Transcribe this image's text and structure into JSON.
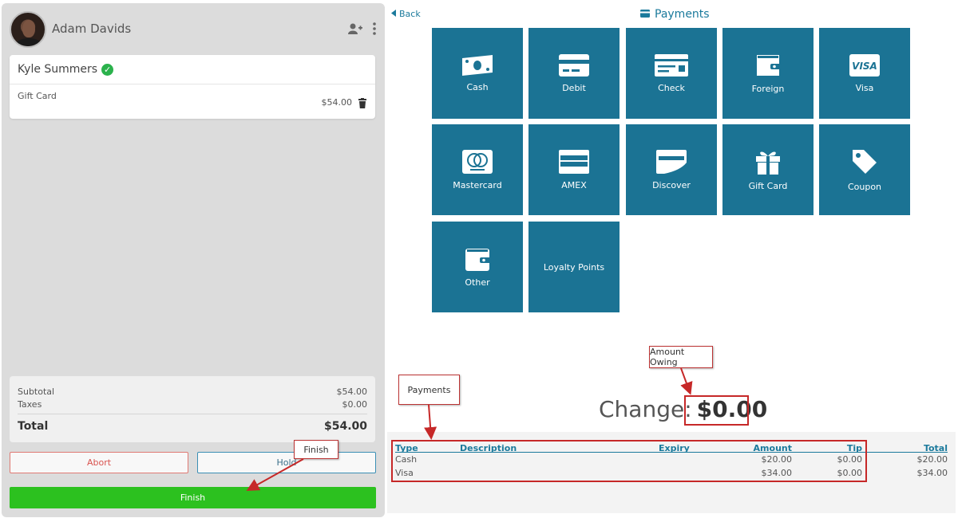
{
  "user": {
    "name": "Adam Davids"
  },
  "customer": {
    "name": "Kyle Summers"
  },
  "items": [
    {
      "name": "Gift Card",
      "price": "$54.00"
    }
  ],
  "totals": {
    "subtotal_label": "Subtotal",
    "subtotal": "$54.00",
    "taxes_label": "Taxes",
    "taxes": "$0.00",
    "total_label": "Total",
    "total": "$54.00"
  },
  "actions": {
    "abort": "Abort",
    "hold": "Hold",
    "finish": "Finish"
  },
  "nav": {
    "back": "Back",
    "title": "Payments"
  },
  "payment_methods": [
    "Cash",
    "Debit",
    "Check",
    "Foreign",
    "Visa",
    "Mastercard",
    "AMEX",
    "Discover",
    "Gift Card",
    "Coupon",
    "Other",
    "Loyalty Points"
  ],
  "change": {
    "label": "Change:",
    "amount": "$0.00"
  },
  "payments_table": {
    "headers": {
      "type": "Type",
      "description": "Description",
      "expiry": "Expiry",
      "amount": "Amount",
      "tip": "Tip",
      "total": "Total"
    },
    "rows": [
      {
        "type": "Cash",
        "description": "",
        "expiry": "",
        "amount": "$20.00",
        "tip": "$0.00",
        "total": "$20.00"
      },
      {
        "type": "Visa",
        "description": "",
        "expiry": "",
        "amount": "$34.00",
        "tip": "$0.00",
        "total": "$34.00"
      }
    ]
  },
  "annotations": {
    "amount_owing": "Amount Owing",
    "payments": "Payments",
    "finish": "Finish"
  },
  "colors": {
    "tile": "#1b7394",
    "accent": "#1b7a9c",
    "finish": "#2cc11f",
    "annotation": "#c62828"
  }
}
